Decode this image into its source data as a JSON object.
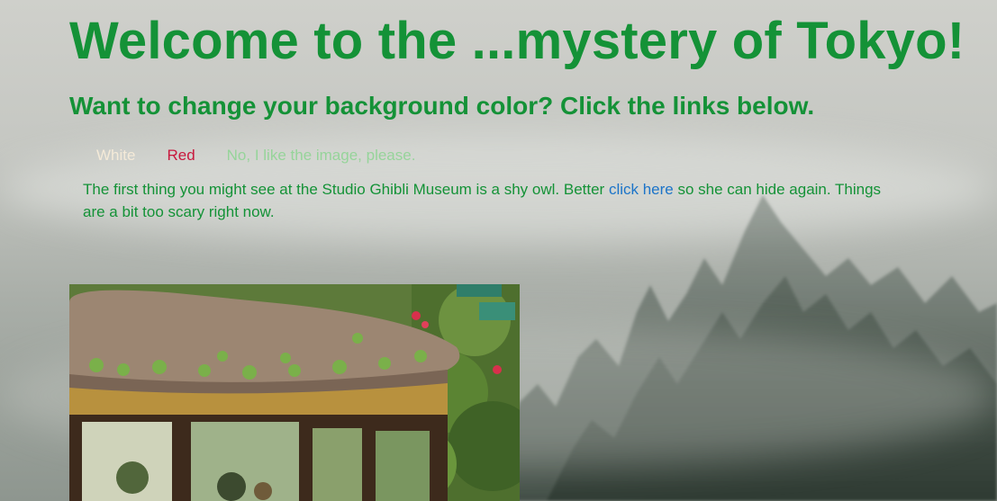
{
  "page": {
    "title": "Welcome to the ...mystery of Tokyo!",
    "subtitle": "Want to change your background color? Click the links below."
  },
  "color_links": [
    {
      "label": "White",
      "color": "#f4ead8"
    },
    {
      "label": "Red",
      "color": "#c8183d"
    },
    {
      "label": "No, I like the image, please.",
      "color": "#96d49a"
    }
  ],
  "intro": {
    "before": "The first thing you might see at the Studio Ghibli Museum is a shy owl. Better ",
    "link": "click here",
    "after": " so she can hide again. Things are a bit too scary right now."
  },
  "colors": {
    "heading": "#149237",
    "link": "#1c74c9"
  },
  "images": {
    "photo": "studio-ghibli-museum-photo",
    "background": "foggy-forest-background"
  }
}
